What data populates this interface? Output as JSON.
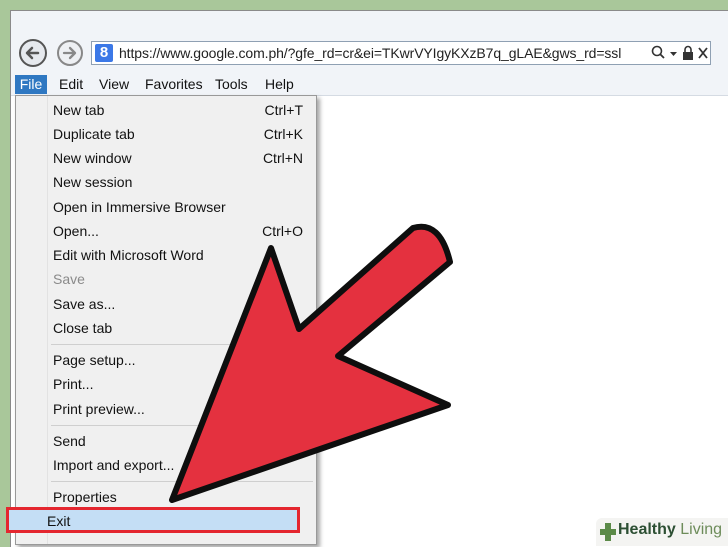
{
  "address_bar": {
    "url": "https://www.google.com.ph/?gfe_rd=cr&ei=TKwrVYIgyKXzB7q_gLAE&gws_rd=ssl",
    "site_icon_letter": "8"
  },
  "menubar": {
    "items": [
      "File",
      "Edit",
      "View",
      "Favorites",
      "Tools",
      "Help"
    ]
  },
  "file_menu": {
    "items": [
      {
        "label": "New tab",
        "shortcut": "Ctrl+T"
      },
      {
        "label": "Duplicate tab",
        "shortcut": "Ctrl+K"
      },
      {
        "label": "New window",
        "shortcut": "Ctrl+N"
      },
      {
        "label": "New session",
        "shortcut": ""
      },
      {
        "label": "Open in Immersive Browser",
        "shortcut": ""
      },
      {
        "label": "Open...",
        "shortcut": "Ctrl+O"
      },
      {
        "label": "Edit with Microsoft Word",
        "shortcut": ""
      },
      {
        "label": "Save",
        "shortcut": "",
        "disabled": true
      },
      {
        "label": "Save as...",
        "shortcut": ""
      },
      {
        "label": "Close tab",
        "shortcut": ""
      },
      {
        "label": "Page setup...",
        "shortcut": ""
      },
      {
        "label": "Print...",
        "shortcut": ""
      },
      {
        "label": "Print preview...",
        "shortcut": ""
      },
      {
        "label": "Send",
        "shortcut": ""
      },
      {
        "label": "Import and export...",
        "shortcut": ""
      },
      {
        "label": "Properties",
        "shortcut": ""
      },
      {
        "label": "Exit",
        "shortcut": "",
        "highlighted": true
      }
    ]
  },
  "watermark": {
    "brand_part1": "Healthy",
    "brand_part2": "Living"
  },
  "colors": {
    "background": "#a9c79a",
    "highlight_border": "#e4262f",
    "arrow": "#e4313f",
    "menu_selected": "#2f78c2"
  }
}
